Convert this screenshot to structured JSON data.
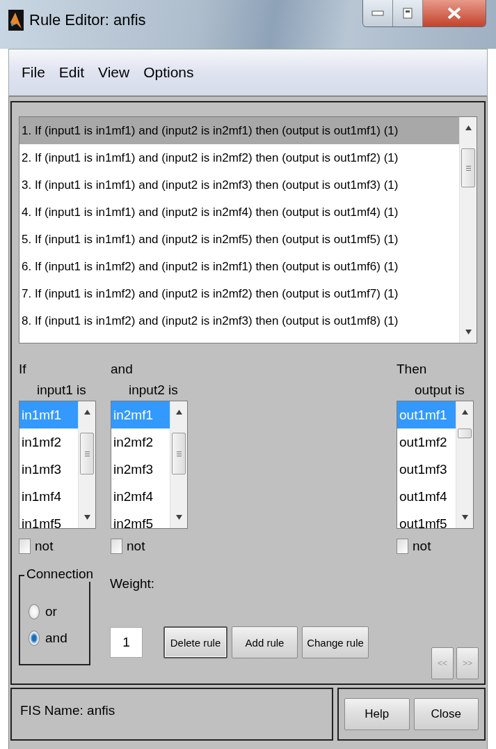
{
  "window": {
    "title": "Rule Editor: anfis"
  },
  "menu": [
    "File",
    "Edit",
    "View",
    "Options"
  ],
  "rules": [
    {
      "text": "1. If (input1 is in1mf1) and (input2 is in2mf1) then (output is out1mf1) (1)",
      "selected": true
    },
    {
      "text": "2. If (input1 is in1mf1) and (input2 is in2mf2) then (output is out1mf2) (1)",
      "selected": false
    },
    {
      "text": "3. If (input1 is in1mf1) and (input2 is in2mf3) then (output is out1mf3) (1)",
      "selected": false
    },
    {
      "text": "4. If (input1 is in1mf1) and (input2 is in2mf4) then (output is out1mf4) (1)",
      "selected": false
    },
    {
      "text": "5. If (input1 is in1mf1) and (input2 is in2mf5) then (output is out1mf5) (1)",
      "selected": false
    },
    {
      "text": "6. If (input1 is in1mf2) and (input2 is in2mf1) then (output is out1mf6) (1)",
      "selected": false
    },
    {
      "text": "7. If (input1 is in1mf2) and (input2 is in2mf2) then (output is out1mf7) (1)",
      "selected": false
    },
    {
      "text": "8. If (input1 is in1mf2) and (input2 is in2mf3) then (output is out1mf8) (1)",
      "selected": false
    }
  ],
  "antecedents": [
    {
      "header": "If",
      "label": "input1 is",
      "not": false,
      "not_label": "not",
      "items": [
        {
          "label": "in1mf1",
          "selected": true
        },
        {
          "label": "in1mf2",
          "selected": false
        },
        {
          "label": "in1mf3",
          "selected": false
        },
        {
          "label": "in1mf4",
          "selected": false
        },
        {
          "label": "in1mf5",
          "selected": false
        }
      ]
    },
    {
      "header": "and",
      "label": "input2 is",
      "not": false,
      "not_label": "not",
      "items": [
        {
          "label": "in2mf1",
          "selected": true
        },
        {
          "label": "in2mf2",
          "selected": false
        },
        {
          "label": "in2mf3",
          "selected": false
        },
        {
          "label": "in2mf4",
          "selected": false
        },
        {
          "label": "in2mf5",
          "selected": false
        }
      ]
    }
  ],
  "consequent": {
    "header": "Then",
    "label": "output is",
    "not": false,
    "not_label": "not",
    "items": [
      {
        "label": "out1mf1",
        "selected": true
      },
      {
        "label": "out1mf2",
        "selected": false
      },
      {
        "label": "out1mf3",
        "selected": false
      },
      {
        "label": "out1mf4",
        "selected": false
      },
      {
        "label": "out1mf5",
        "selected": false
      }
    ]
  },
  "connection": {
    "title": "Connection",
    "options": [
      {
        "label": "or",
        "selected": false
      },
      {
        "label": "and",
        "selected": true
      }
    ]
  },
  "weight": {
    "label": "Weight:",
    "value": "1"
  },
  "rule_buttons": [
    {
      "label": "Delete rule",
      "focused": true
    },
    {
      "label": "Add rule",
      "focused": false
    },
    {
      "label": "Change rule",
      "focused": false
    }
  ],
  "nav_buttons": [
    {
      "label": "<<",
      "disabled": true
    },
    {
      "label": ">>",
      "disabled": true
    }
  ],
  "status": "FIS Name: anfis",
  "footer_buttons": [
    "Help",
    "Close"
  ]
}
